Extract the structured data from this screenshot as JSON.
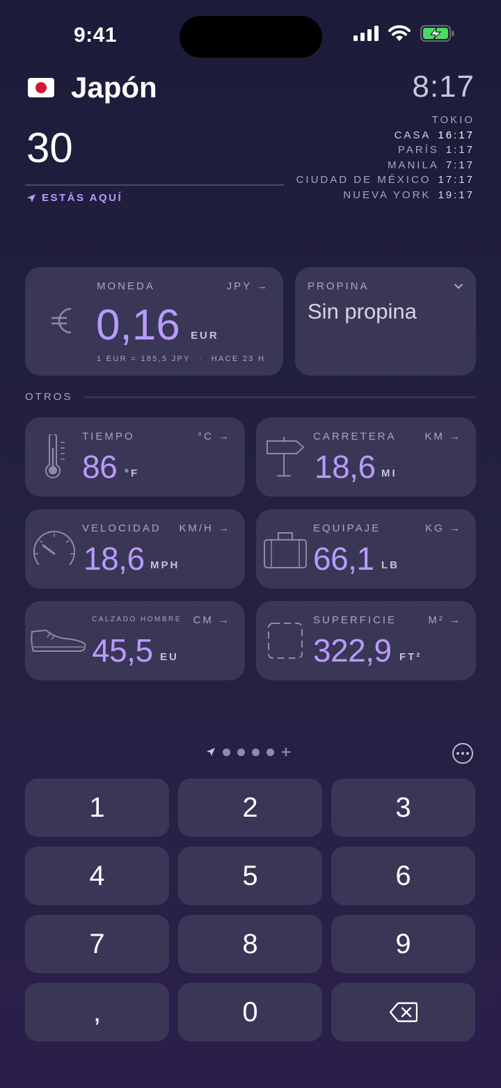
{
  "status_bar": {
    "time": "9:41"
  },
  "header": {
    "country": "Japón",
    "input_value": "30",
    "location_label": "ESTÁS AQUÍ",
    "local_time": "8:17",
    "cities": [
      {
        "name": "TOKIO",
        "time": ""
      },
      {
        "name": "CASA",
        "time": "16:17"
      },
      {
        "name": "PARÍS",
        "time": "1:17"
      },
      {
        "name": "MANILA",
        "time": "7:17"
      },
      {
        "name": "CIUDAD DE MÉXICO",
        "time": "17:17"
      },
      {
        "name": "NUEVA YORK",
        "time": "19:17"
      }
    ]
  },
  "currency": {
    "label": "MONEDA",
    "switch": "JPY",
    "value": "0,16",
    "unit": "EUR",
    "rate": "1 EUR = 185,5 JPY",
    "updated": "HACE 23 H",
    "icon": "euro-icon"
  },
  "tip": {
    "label": "PROPINA",
    "value": "Sin propina"
  },
  "section": {
    "title": "OTROS"
  },
  "conversions": {
    "weather": {
      "label": "TIEMPO",
      "switch": "°C",
      "value": "86",
      "unit": "°F",
      "icon": "thermometer-icon"
    },
    "road": {
      "label": "CARRETERA",
      "switch": "KM",
      "value": "18,6",
      "unit": "MI",
      "icon": "signpost-icon"
    },
    "speed": {
      "label": "VELOCIDAD",
      "switch": "KM/H",
      "value": "18,6",
      "unit": "MPH",
      "icon": "speedometer-icon"
    },
    "luggage": {
      "label": "EQUIPAJE",
      "switch": "KG",
      "value": "66,1",
      "unit": "LB",
      "icon": "suitcase-icon"
    },
    "shoes": {
      "label": "CALZADO HOMBRE",
      "switch": "CM",
      "value": "45,5",
      "unit": "EU",
      "icon": "shoe-icon"
    },
    "area": {
      "label": "SUPERFICIE",
      "switch": "M²",
      "value": "322,9",
      "unit": "FT²",
      "icon": "area-icon"
    }
  },
  "keypad": {
    "keys": [
      "1",
      "2",
      "3",
      "4",
      "5",
      "6",
      "7",
      "8",
      "9",
      ",",
      "0"
    ]
  }
}
